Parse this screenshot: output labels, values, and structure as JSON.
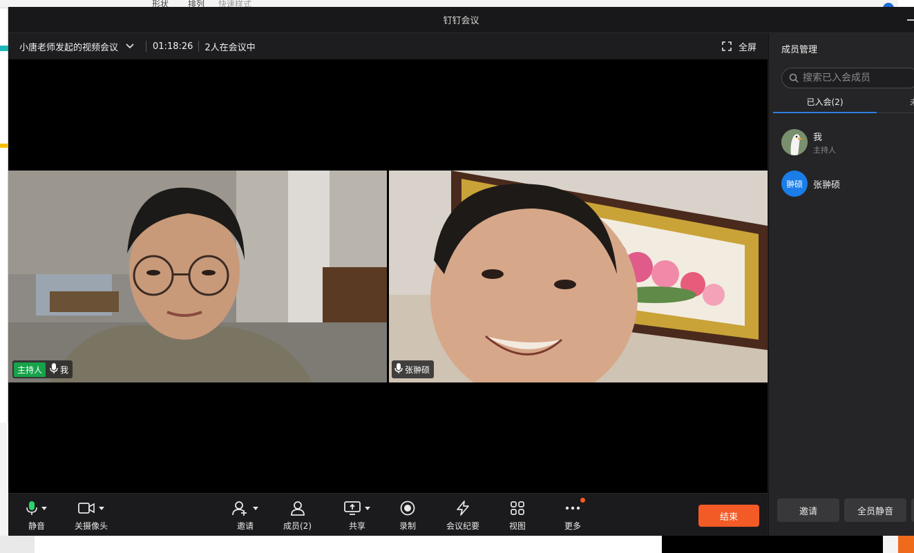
{
  "background_app": {
    "ribbon_items": [
      "形状",
      "排列",
      "快速样式"
    ]
  },
  "window": {
    "title": "钉钉会议"
  },
  "meeting": {
    "name": "小唐老师发起的视频会议",
    "elapsed": "01:18:26",
    "participants_status": "2人在会议中",
    "fullscreen_label": "全屏"
  },
  "tiles": [
    {
      "host_badge": "主持人",
      "name": "我"
    },
    {
      "name": "张翀硕"
    }
  ],
  "toolbar": {
    "mute": "静音",
    "camera_off": "关摄像头",
    "invite": "邀请",
    "members": "成员(2)",
    "share": "共享",
    "record": "录制",
    "summary": "会议纪要",
    "view": "视图",
    "more": "更多",
    "end": "结束"
  },
  "panel": {
    "title": "成员管理",
    "search_placeholder": "搜索已入会成员",
    "tab_joined": "已入会(2)",
    "tab_other": "未",
    "members": [
      {
        "name": "我",
        "role": "主持人"
      },
      {
        "name": "张翀硕",
        "avatar_text": "翀硕",
        "avatar_color": "#1a7de8"
      }
    ],
    "invite_button": "邀请",
    "mute_all_button": "全员静音"
  },
  "colors": {
    "end_button": "#f25a26",
    "host_badge": "#16a34a",
    "tab_underline": "#2f7fe0"
  }
}
